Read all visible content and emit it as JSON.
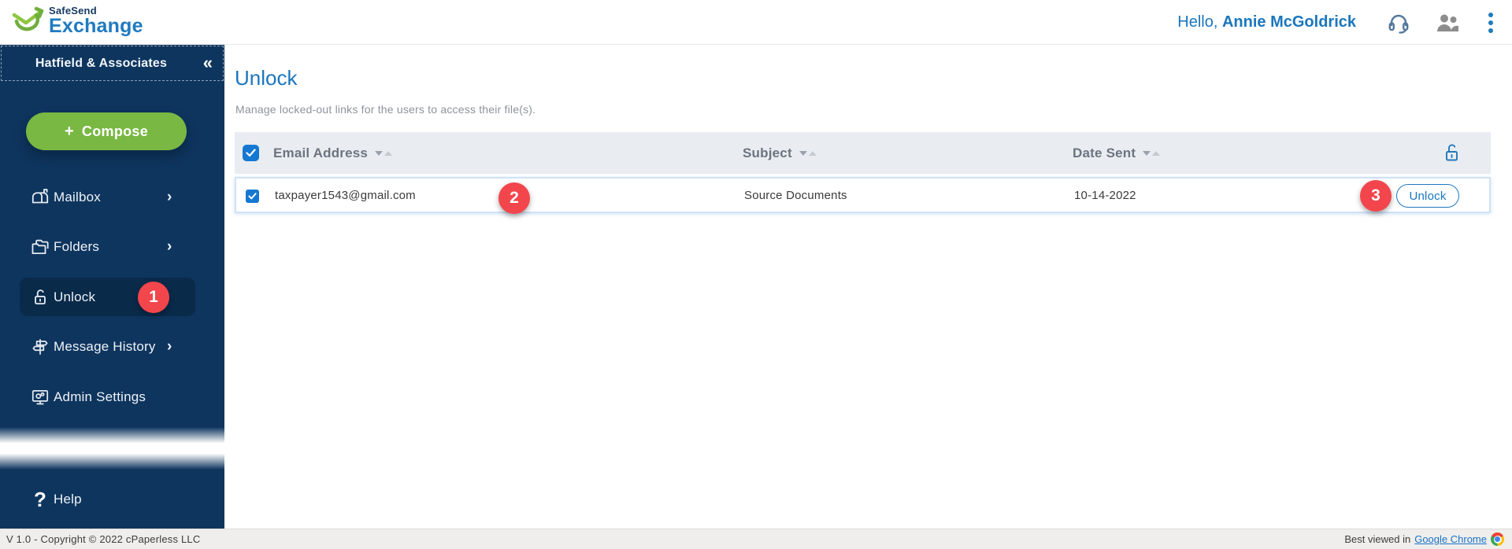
{
  "topbar": {
    "brand_line1": "SafeSend",
    "brand_line2": "Exchange",
    "greeting_prefix": "Hello,",
    "user_name": "Annie McGoldrick",
    "icons": [
      "headset-icon",
      "users-icon",
      "kebab-menu-icon"
    ]
  },
  "sidebar": {
    "org_name": "Hatfield & Associates",
    "collapse_icon": "«",
    "compose": {
      "plus": "+",
      "label": "Compose"
    },
    "items": [
      {
        "label": "Mailbox",
        "icon": "mailbox-icon",
        "chevron": "›"
      },
      {
        "label": "Folders",
        "icon": "folders-icon",
        "chevron": "›"
      },
      {
        "label": "Unlock",
        "icon": "unlock-icon",
        "active": true
      },
      {
        "label": "Message History",
        "icon": "signpost-icon",
        "chevron": "›"
      },
      {
        "label": "Admin Settings",
        "icon": "monitor-gear-icon"
      },
      {
        "label": "Help",
        "icon": "question-icon"
      }
    ]
  },
  "main": {
    "title": "Unlock",
    "description": "Manage locked-out links for the users to access their file(s).",
    "table": {
      "columns": [
        "Email Address",
        "Subject",
        "Date Sent"
      ],
      "header_checkbox_checked": true,
      "unlock_all_icon": "lock-open-icon",
      "rows": [
        {
          "checked": true,
          "email": "taxpayer1543@gmail.com",
          "subject": "Source Documents",
          "date_sent": "10-14-2022",
          "action_label": "Unlock"
        }
      ]
    }
  },
  "annotations": {
    "step1": "1",
    "step2": "2",
    "step3": "3"
  },
  "footer": {
    "left_text": "V 1.0 - Copyright © 2022  cPaperless LLC",
    "right_prefix": "Best viewed in",
    "right_link": "Google Chrome",
    "chrome_icon": "chrome-icon"
  },
  "colors": {
    "sidebar_navy": "#0e355e",
    "active_item_navy": "#0a2a4a",
    "accent_blue": "#1b76bc",
    "compose_green": "#79b843",
    "badge_red": "#f2464c",
    "table_header_bg": "#e9edf1",
    "row_border_blue": "#cfe3f6",
    "footer_bg": "#efeeec"
  }
}
